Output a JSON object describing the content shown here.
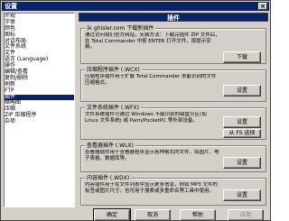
{
  "window": {
    "title": "设置",
    "close_glyph": "×"
  },
  "tree": {
    "items": [
      {
        "label": "外观",
        "selected": false
      },
      {
        "label": "  字体",
        "selected": false
      },
      {
        "label": "  颜色",
        "selected": false
      },
      {
        "label": "  图标",
        "selected": false
      },
      {
        "label": "  对话布局",
        "selected": false
      },
      {
        "label": "  文件系统",
        "selected": false
      },
      {
        "label": "  文件",
        "selected": false
      },
      {
        "label": "  语言 (Language)",
        "selected": false
      },
      {
        "label": "操作",
        "selected": false
      },
      {
        "label": "  编辑/查看",
        "selected": false
      },
      {
        "label": "  复制/删除",
        "selected": false
      },
      {
        "label": "  刷新",
        "selected": false
      },
      {
        "label": "  FTP",
        "selected": false
      },
      {
        "label": "插件",
        "selected": true
      },
      {
        "label": "  缩略图",
        "selected": false
      },
      {
        "label": "压缩",
        "selected": false
      },
      {
        "label": "  ZIP 压缩程序",
        "selected": false
      },
      {
        "label": "杂项",
        "selected": false
      }
    ]
  },
  "panel": {
    "header": "插件",
    "groups": [
      {
        "title": "从 ghisler.com 下载新插件",
        "desc": "通过访问我们官方网站，安装方法：下载完插件 ZIP 文件后，在 Total Commander 中按 ENTER 打开文件，按提示安装。",
        "button": "下载"
      },
      {
        "title": "压缩程序插件 (.WCX)",
        "desc": "压缩程序插件用于扩展 Total Commander 未能识别的文件压缩格式。",
        "button": "设置"
      },
      {
        "title": "文件系统插件 (.WFX)",
        "desc": "文件系统插件可通过 Windows 不能识别的磁盘分区(如 Linux 文件系统) 或 Palm/PocketPC 等外部设备。",
        "button": "设置",
        "button2": "从 FS 选择"
      },
      {
        "title": "查看器插件 (.WLX)",
        "desc": "查看器插件用于查看器程序显示各种格式的文件，如图片、电子表格、数据库等。",
        "button": "设置"
      },
      {
        "title": "内容插件 (.WDX)",
        "desc": "内容插件用于在文件列表中显示更多信息，例如 MP3 文件的标签或图片尺寸。也可用于搜索或多重命名等工具中使用。",
        "button": "设置"
      }
    ]
  },
  "footer": {
    "ok": "确定",
    "cancel": "取消",
    "help": "帮助",
    "apply": "应用"
  },
  "colors": {
    "title_bar": "#0a246a",
    "face": "#d4d0c8",
    "selection": "#0a246a"
  }
}
